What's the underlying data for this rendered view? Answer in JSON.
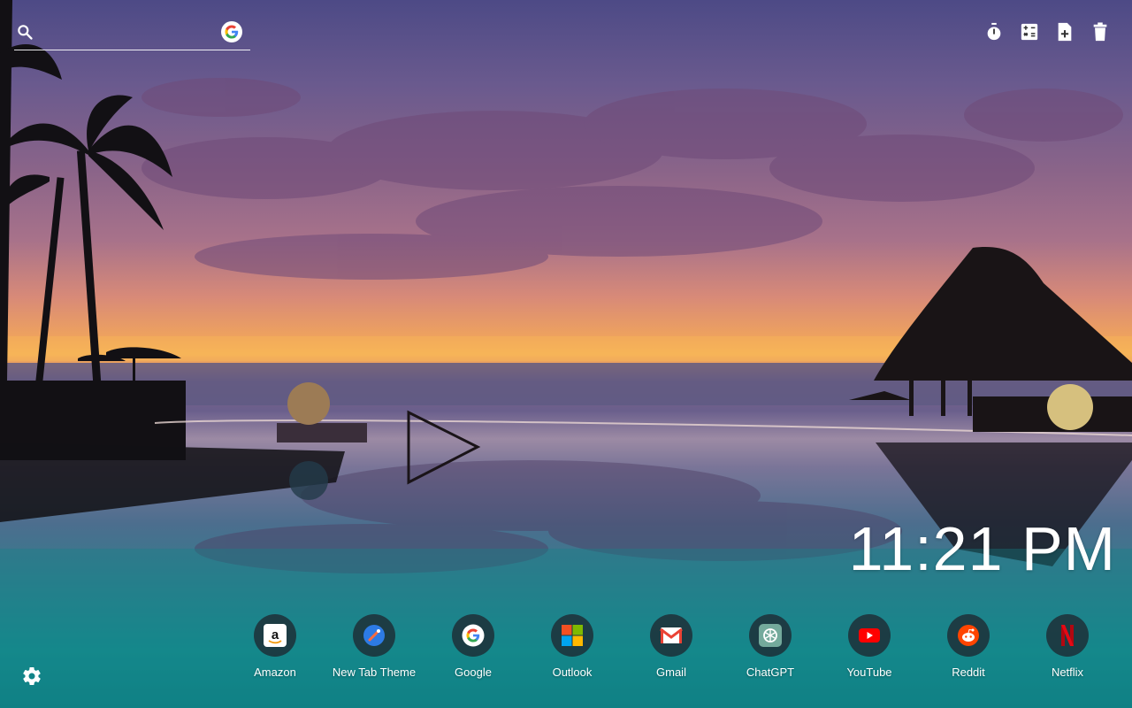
{
  "search": {
    "placeholder": "",
    "value": "",
    "icon": "search-icon",
    "engine_icon": "google-icon"
  },
  "toolbar": {
    "items": [
      {
        "icon": "timer-icon"
      },
      {
        "icon": "calculator-icon"
      },
      {
        "icon": "add-note-icon"
      },
      {
        "icon": "trash-icon"
      }
    ]
  },
  "clock": {
    "time": "11:21 PM"
  },
  "shortcuts": [
    {
      "label": "Amazon",
      "icon": "amazon-icon"
    },
    {
      "label": "New Tab Theme",
      "icon": "new-tab-theme-icon"
    },
    {
      "label": "Google",
      "icon": "google-icon"
    },
    {
      "label": "Outlook",
      "icon": "outlook-icon"
    },
    {
      "label": "Gmail",
      "icon": "gmail-icon"
    },
    {
      "label": "ChatGPT",
      "icon": "chatgpt-icon"
    },
    {
      "label": "YouTube",
      "icon": "youtube-icon"
    },
    {
      "label": "Reddit",
      "icon": "reddit-icon"
    },
    {
      "label": "Netflix",
      "icon": "netflix-icon"
    }
  ],
  "settings": {
    "icon": "gear-icon"
  },
  "colors": {
    "text": "#ffffff",
    "tile_bg": "#1e2028",
    "google_blue": "#4285f4",
    "google_red": "#ea4335",
    "google_yellow": "#fbbc05",
    "google_green": "#34a853"
  }
}
